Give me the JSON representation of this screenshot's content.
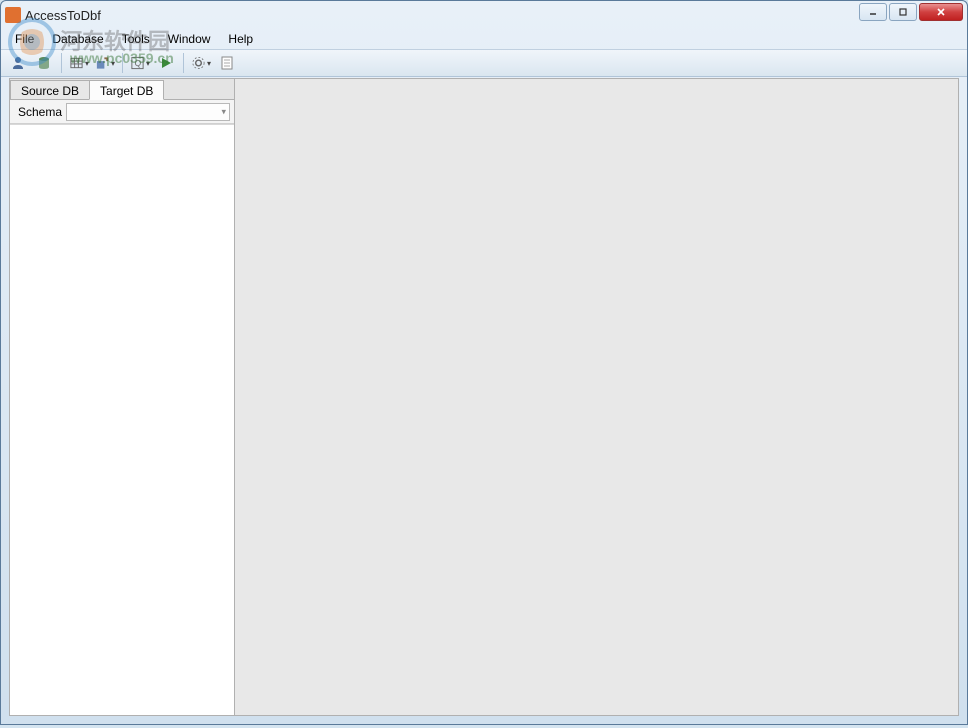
{
  "window": {
    "title": "AccessToDbf"
  },
  "menubar": {
    "file": "File",
    "database": "Database",
    "tools": "Tools",
    "window": "Window",
    "help": "Help"
  },
  "toolbar": {
    "icons": [
      {
        "name": "new-icon"
      },
      {
        "name": "open-icon"
      },
      {
        "name": "save-icon"
      },
      {
        "name": "export-icon"
      },
      {
        "name": "import-icon"
      },
      {
        "name": "table-icon"
      },
      {
        "name": "query-icon"
      },
      {
        "name": "run-icon"
      },
      {
        "name": "stop-icon"
      }
    ]
  },
  "sidebar": {
    "tabs": {
      "source": "Source DB",
      "target": "Target DB"
    },
    "active_tab": "target",
    "schema_label": "Schema",
    "schema_value": ""
  },
  "watermark": {
    "text1": "河东软件园",
    "text2": "www.pc0359.cn"
  }
}
